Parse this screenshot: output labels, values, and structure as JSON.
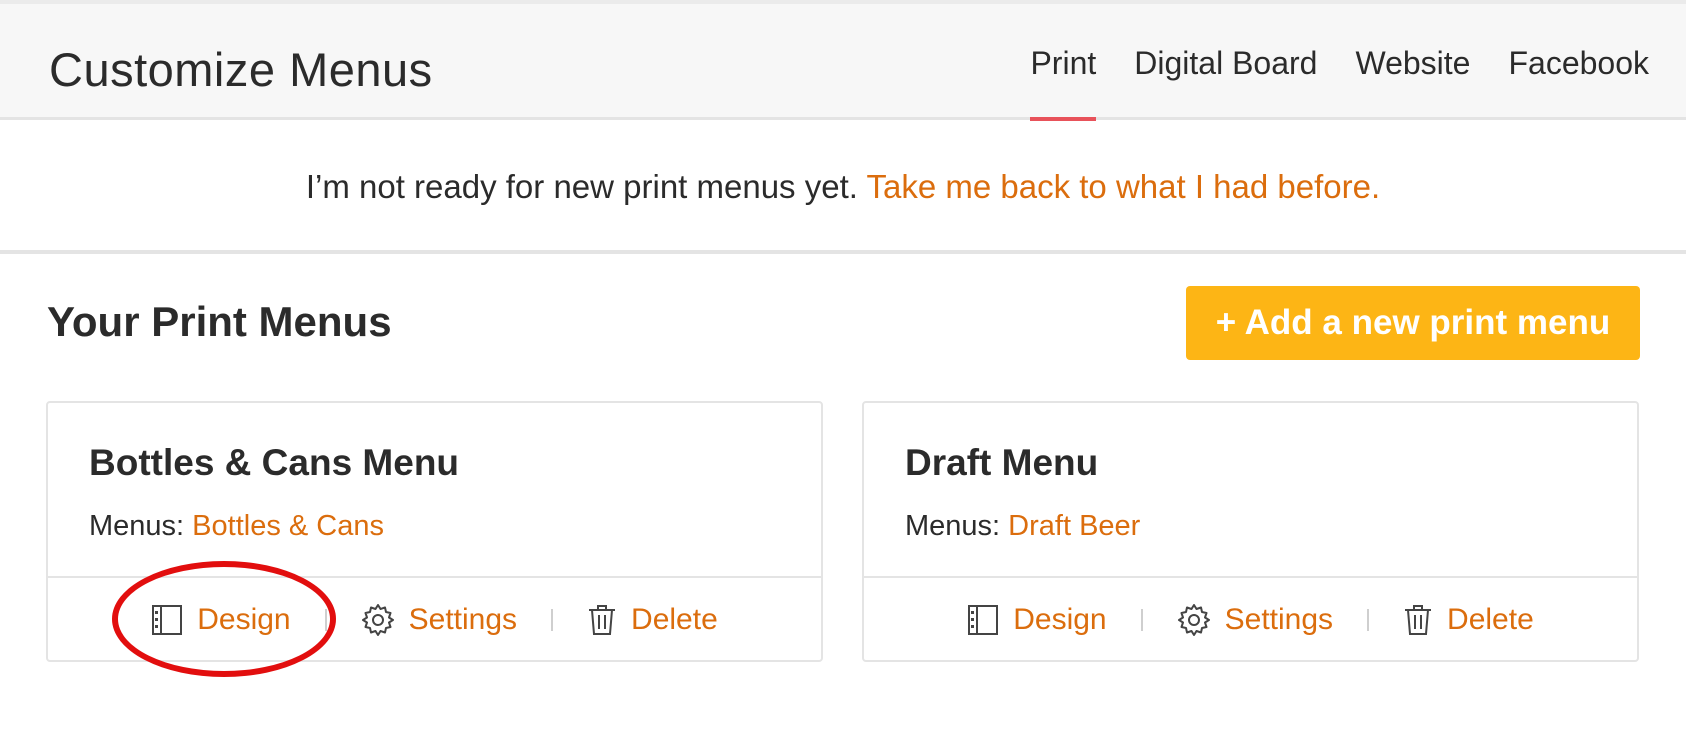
{
  "header": {
    "title": "Customize Menus",
    "tabs": [
      {
        "label": "Print",
        "active": true
      },
      {
        "label": "Digital Board",
        "active": false
      },
      {
        "label": "Website",
        "active": false
      },
      {
        "label": "Facebook",
        "active": false
      }
    ]
  },
  "notice": {
    "text": "I’m not ready for new print menus yet.",
    "link": "Take me back to what I had before."
  },
  "section": {
    "title": "Your Print Menus",
    "add_button": "+ Add a new print menu"
  },
  "cards": [
    {
      "title": "Bottles & Cans Menu",
      "menus_label": "Menus:",
      "menus_link": "Bottles & Cans",
      "actions": {
        "design": "Design",
        "settings": "Settings",
        "delete": "Delete"
      }
    },
    {
      "title": "Draft Menu",
      "menus_label": "Menus:",
      "menus_link": "Draft Beer",
      "actions": {
        "design": "Design",
        "settings": "Settings",
        "delete": "Delete"
      }
    }
  ],
  "colors": {
    "accent_link": "#db6d0d",
    "active_tab_underline": "#e8525a",
    "add_button": "#fdb515",
    "annotation_circle": "#e20e0e"
  },
  "icons": [
    "design-icon",
    "gear-icon",
    "trash-icon"
  ]
}
